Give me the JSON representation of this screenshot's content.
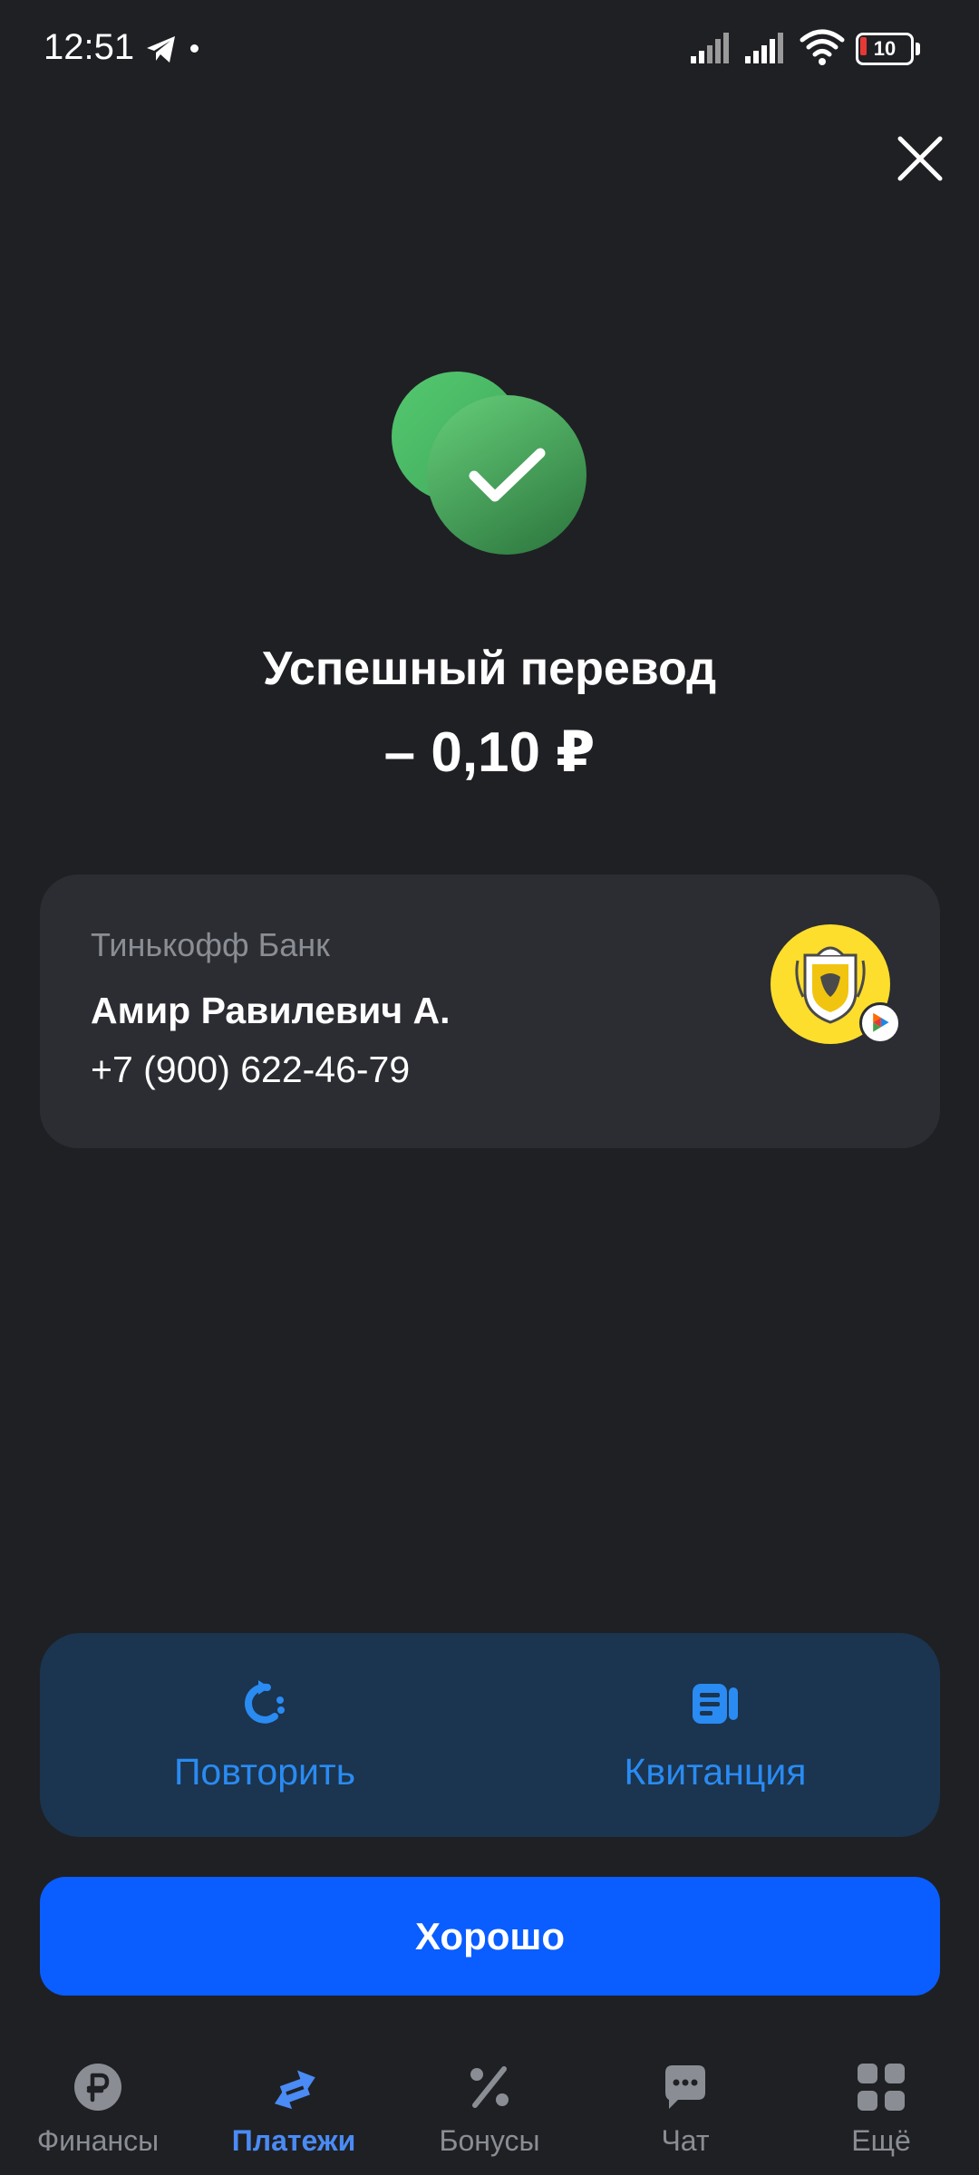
{
  "status_bar": {
    "time": "12:51",
    "battery": "10"
  },
  "result": {
    "title": "Успешный перевод",
    "amount": "– 0,10 ₽"
  },
  "recipient": {
    "bank": "Тинькофф Банк",
    "name": "Амир Равилевич А.",
    "phone": "+7 (900) 622-46-79"
  },
  "actions": {
    "repeat_label": "Повторить",
    "receipt_label": "Квитанция"
  },
  "primary_button": {
    "label": "Хорошо"
  },
  "bottom_nav": {
    "items": [
      {
        "label": "Финансы",
        "icon": "ruble-icon"
      },
      {
        "label": "Платежи",
        "icon": "transfer-icon",
        "active": true
      },
      {
        "label": "Бонусы",
        "icon": "percent-icon"
      },
      {
        "label": "Чат",
        "icon": "chat-icon"
      },
      {
        "label": "Ещё",
        "icon": "grid-icon"
      }
    ]
  },
  "colors": {
    "background": "#1f2024",
    "card": "#2b2d32",
    "action_panel": "#1b344f",
    "accent": "#0a5dff",
    "link": "#2a8bf2",
    "success": "#4fbf67",
    "tinkoff_yellow": "#fdde2c"
  }
}
